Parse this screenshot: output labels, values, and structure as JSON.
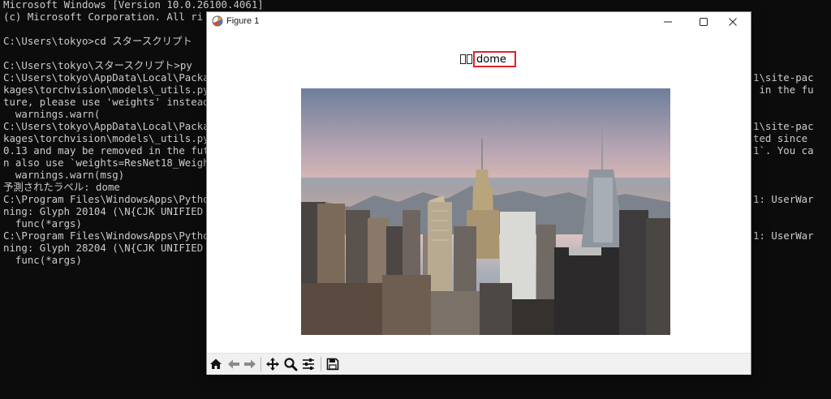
{
  "console": {
    "left_lines": [
      "Microsoft Windows [Version 10.0.26100.4061]",
      "(c) Microsoft Corporation. All ri",
      "",
      "C:\\Users\\tokyo>cd スタースクリプト",
      "",
      "C:\\Users\\tokyo\\スタースクリプト>py",
      "C:\\Users\\tokyo\\AppData\\Local\\Packa",
      "kages\\torchvision\\models\\_utils.py",
      "ture, please use 'weights' instead",
      "  warnings.warn(",
      "C:\\Users\\tokyo\\AppData\\Local\\Packa",
      "kages\\torchvision\\models\\_utils.py",
      "0.13 and may be removed in the fut",
      "n also use `weights=ResNet18_Weigh",
      "  warnings.warn(msg)",
      "予測されたラベル: dome",
      "C:\\Program Files\\WindowsApps\\Pytho",
      "ning: Glyph 20104 (\\N{CJK UNIFIED",
      "  func(*args)",
      "C:\\Program Files\\WindowsApps\\Pytho",
      "ning: Glyph 28204 (\\N{CJK UNIFIED",
      "  func(*args)"
    ],
    "right_lines": [
      "",
      "",
      "",
      "",
      "",
      "",
      "1\\site-pac",
      " in the fu",
      "",
      "",
      "1\\site-pac",
      "ted since",
      "1`. You ca",
      "",
      "",
      "",
      "1: UserWar",
      "",
      "",
      "1: UserWar",
      "",
      ""
    ]
  },
  "window": {
    "title": "Figure 1"
  },
  "figure": {
    "title_label": "dome",
    "highlight_color": "#e0202a",
    "photo_description_icon": "city-skyline-photo"
  },
  "toolbar": {
    "buttons": [
      "home",
      "back",
      "forward",
      "pan",
      "zoom",
      "configure-subplots",
      "save"
    ]
  }
}
